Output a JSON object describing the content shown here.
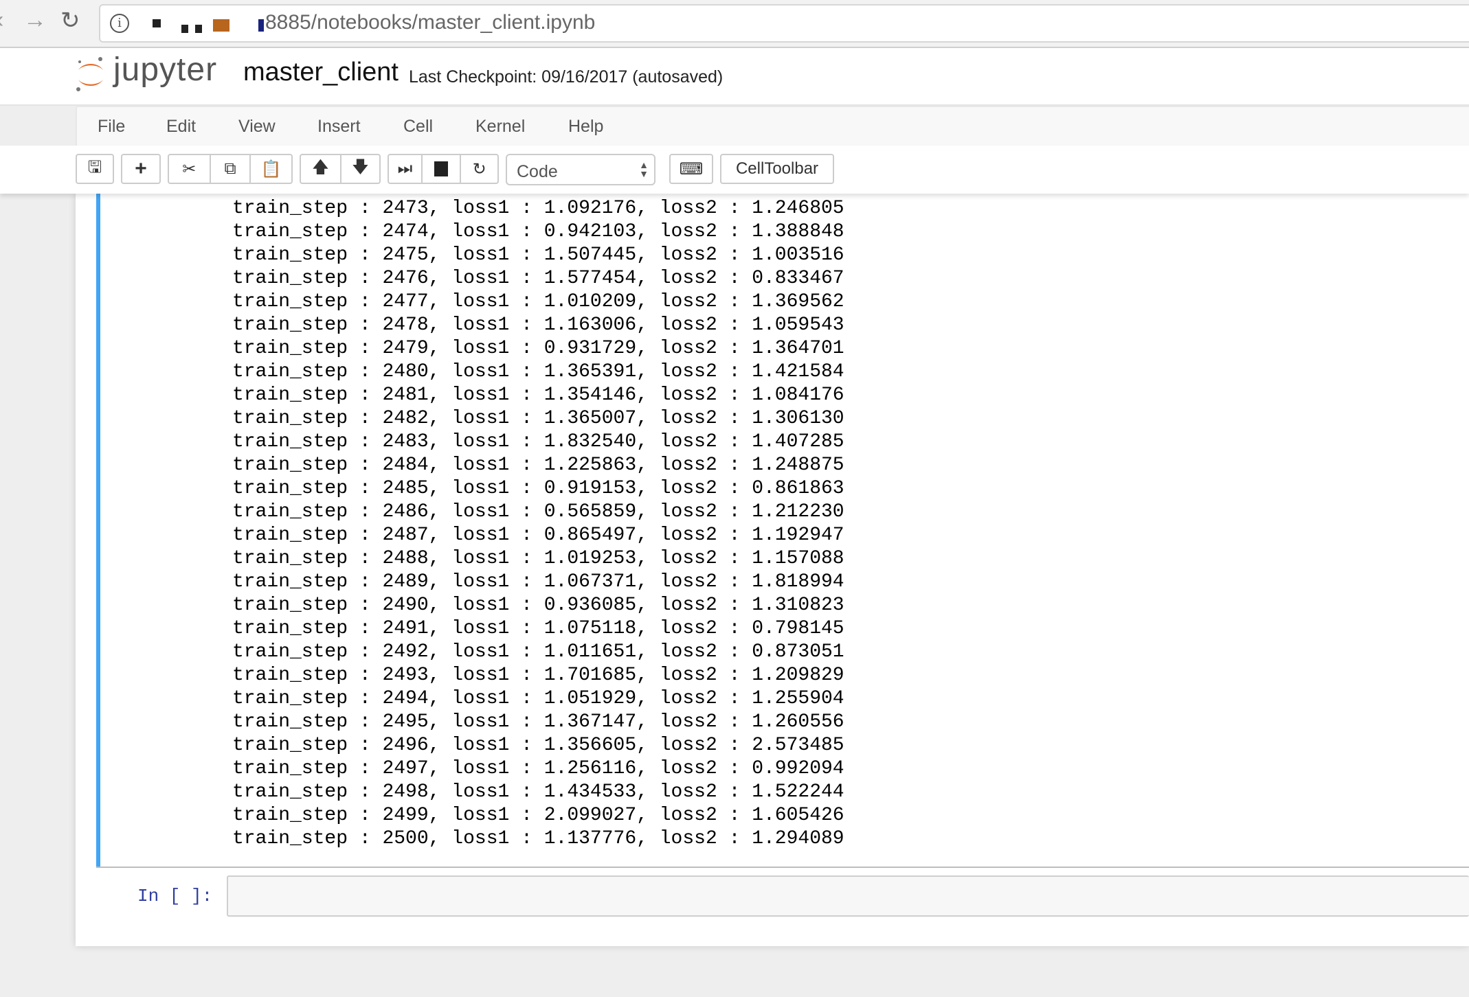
{
  "browser": {
    "url": "8885/notebooks/master_client.ipynb"
  },
  "header": {
    "logo_text": "jupyter",
    "notebook_name": "master_client",
    "checkpoint": "Last Checkpoint: 09/16/2017 (autosaved)"
  },
  "menu": [
    "File",
    "Edit",
    "View",
    "Insert",
    "Cell",
    "Kernel",
    "Help"
  ],
  "toolbar": {
    "cell_type": "Code",
    "celltoolbar_label": "CellToolbar",
    "icons": [
      "save-icon",
      "plus-icon",
      "scissors-icon",
      "copy-icon",
      "paste-icon",
      "arrow-up-icon",
      "arrow-down-icon",
      "run-icon",
      "stop-icon",
      "restart-icon",
      "keyboard-icon"
    ]
  },
  "output": {
    "labels": {
      "step": "train_step",
      "loss1": "loss1",
      "loss2": "loss2"
    },
    "rows": [
      {
        "step": "2473",
        "loss1": "1.092176",
        "loss2": "1.246805"
      },
      {
        "step": "2474",
        "loss1": "0.942103",
        "loss2": "1.388848"
      },
      {
        "step": "2475",
        "loss1": "1.507445",
        "loss2": "1.003516"
      },
      {
        "step": "2476",
        "loss1": "1.577454",
        "loss2": "0.833467"
      },
      {
        "step": "2477",
        "loss1": "1.010209",
        "loss2": "1.369562"
      },
      {
        "step": "2478",
        "loss1": "1.163006",
        "loss2": "1.059543"
      },
      {
        "step": "2479",
        "loss1": "0.931729",
        "loss2": "1.364701"
      },
      {
        "step": "2480",
        "loss1": "1.365391",
        "loss2": "1.421584"
      },
      {
        "step": "2481",
        "loss1": "1.354146",
        "loss2": "1.084176"
      },
      {
        "step": "2482",
        "loss1": "1.365007",
        "loss2": "1.306130"
      },
      {
        "step": "2483",
        "loss1": "1.832540",
        "loss2": "1.407285"
      },
      {
        "step": "2484",
        "loss1": "1.225863",
        "loss2": "1.248875"
      },
      {
        "step": "2485",
        "loss1": "0.919153",
        "loss2": "0.861863"
      },
      {
        "step": "2486",
        "loss1": "0.565859",
        "loss2": "1.212230"
      },
      {
        "step": "2487",
        "loss1": "0.865497",
        "loss2": "1.192947"
      },
      {
        "step": "2488",
        "loss1": "1.019253",
        "loss2": "1.157088"
      },
      {
        "step": "2489",
        "loss1": "1.067371",
        "loss2": "1.818994"
      },
      {
        "step": "2490",
        "loss1": "0.936085",
        "loss2": "1.310823"
      },
      {
        "step": "2491",
        "loss1": "1.075118",
        "loss2": "0.798145"
      },
      {
        "step": "2492",
        "loss1": "1.011651",
        "loss2": "0.873051"
      },
      {
        "step": "2493",
        "loss1": "1.701685",
        "loss2": "1.209829"
      },
      {
        "step": "2494",
        "loss1": "1.051929",
        "loss2": "1.255904"
      },
      {
        "step": "2495",
        "loss1": "1.367147",
        "loss2": "1.260556"
      },
      {
        "step": "2496",
        "loss1": "1.356605",
        "loss2": "2.573485"
      },
      {
        "step": "2497",
        "loss1": "1.256116",
        "loss2": "0.992094"
      },
      {
        "step": "2498",
        "loss1": "1.434533",
        "loss2": "1.522244"
      },
      {
        "step": "2499",
        "loss1": "2.099027",
        "loss2": "1.605426"
      },
      {
        "step": "2500",
        "loss1": "1.137776",
        "loss2": "1.294089"
      }
    ]
  },
  "input_cell": {
    "prompt": "In [ ]:"
  },
  "colors": {
    "cell_selected_bar": "#42a5f5",
    "prompt": "#303f9f",
    "logo_orange": "#e46e2e"
  }
}
